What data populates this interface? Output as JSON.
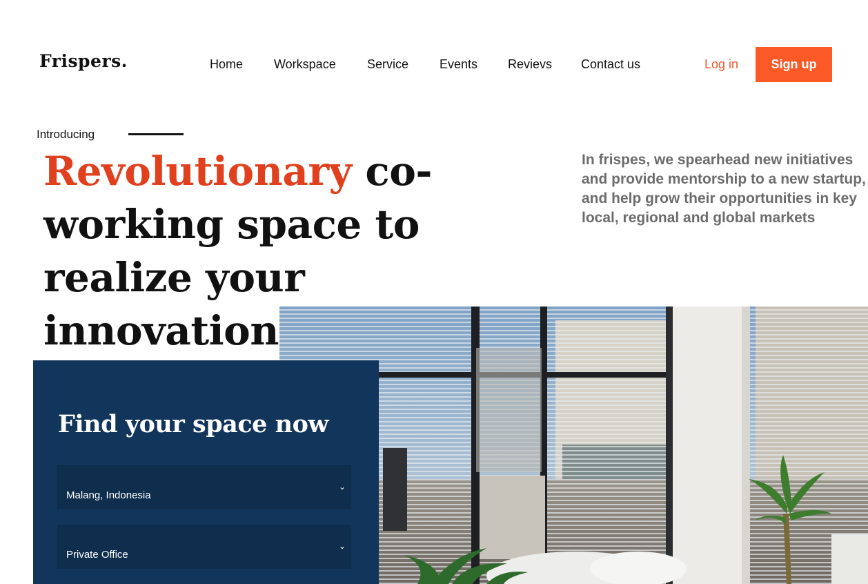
{
  "brand": {
    "logo": "Frispers."
  },
  "nav": {
    "items": [
      "Home",
      "Workspace",
      "Service",
      "Events",
      "Revievs",
      "Contact us"
    ],
    "login_label": "Log in",
    "signup_label": "Sign up"
  },
  "hero": {
    "intro": "Introducing",
    "headline_accent": "Revolutionary",
    "headline_rest": " co-working space to realize your innovation",
    "description": "In frispes, we spearhead new initiatives and provide mentorship to a new startup, and help grow their opportunities in key local, regional and global markets"
  },
  "search": {
    "title": "Find your space now",
    "location_value": "Malang, Indonesia",
    "space_type_value": "Private Office"
  },
  "icons": {
    "select_arrow": "chevron-down-icon"
  },
  "colors": {
    "accent": "#fb5a26",
    "headline_accent": "#e0401e",
    "panel": "#12355b",
    "select_bg": "#0f2d4d",
    "muted_text": "#6c6c6c"
  }
}
